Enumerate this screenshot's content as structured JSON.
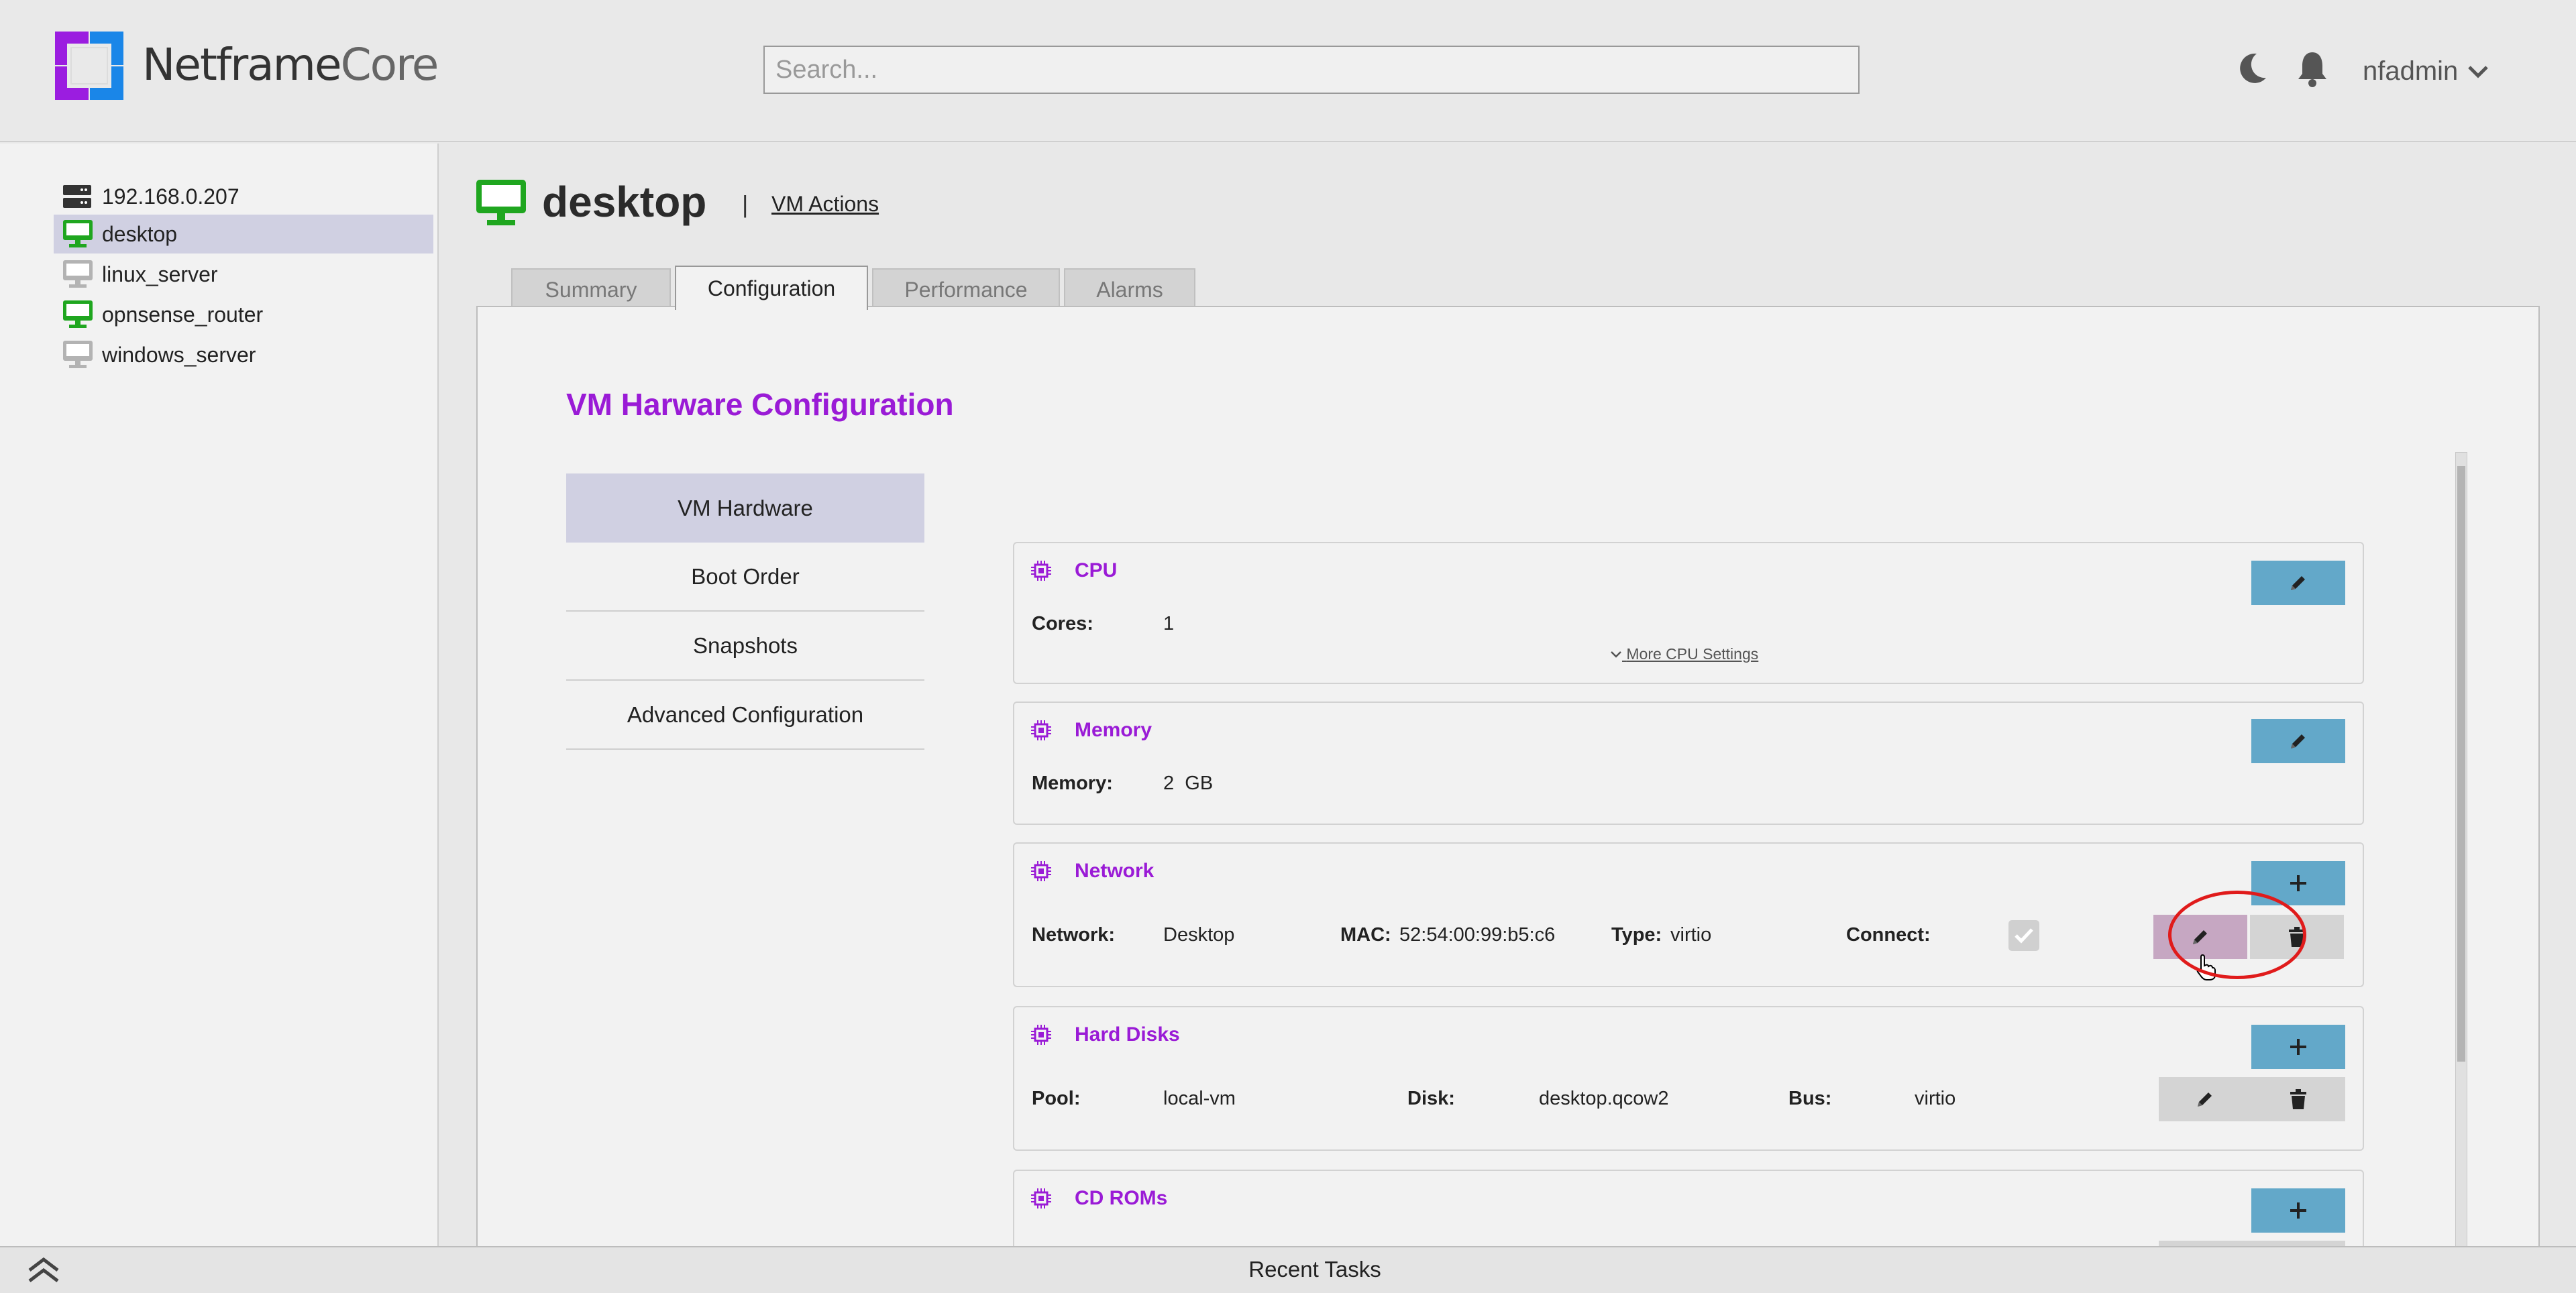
{
  "app": {
    "brand_part1": "Netframe",
    "brand_part2": "Core",
    "search_placeholder": "Search...",
    "user": "nfadmin",
    "icons": [
      "moon-icon",
      "bell-icon",
      "chevron-down-icon"
    ],
    "colors": {
      "accent": "#9a1bd6",
      "button": "#63a8c9",
      "running": "#1fa61f",
      "stopped": "#b3b3b3"
    }
  },
  "sidebar": {
    "items": [
      {
        "label": "192.168.0.207",
        "type": "host"
      },
      {
        "label": "desktop",
        "type": "vm",
        "state": "running",
        "selected": true
      },
      {
        "label": "linux_server",
        "type": "vm",
        "state": "stopped"
      },
      {
        "label": "opnsense_router",
        "type": "vm",
        "state": "running"
      },
      {
        "label": "windows_server",
        "type": "vm",
        "state": "stopped"
      }
    ]
  },
  "vm": {
    "name": "desktop",
    "separator": "|",
    "actions_label": "VM Actions"
  },
  "tabs": [
    {
      "label": "Summary"
    },
    {
      "label": "Configuration",
      "active": true
    },
    {
      "label": "Performance"
    },
    {
      "label": "Alarms"
    }
  ],
  "config": {
    "title": "VM Harware Configuration",
    "menu": [
      {
        "label": "VM Hardware",
        "active": true
      },
      {
        "label": "Boot Order"
      },
      {
        "label": "Snapshots"
      },
      {
        "label": "Advanced Configuration"
      }
    ],
    "cpu": {
      "title": "CPU",
      "cores_label": "Cores:",
      "cores_value": "1",
      "more_label": "More CPU Settings"
    },
    "memory": {
      "title": "Memory",
      "label": "Memory:",
      "value": "2",
      "unit": "GB"
    },
    "network": {
      "title": "Network",
      "network_label": "Network:",
      "network_value": "Desktop",
      "mac_label": "MAC:",
      "mac_value": "52:54:00:99:b5:c6",
      "type_label": "Type:",
      "type_value": "virtio",
      "connect_label": "Connect:",
      "connected": true
    },
    "disks": {
      "title": "Hard Disks",
      "pool_label": "Pool:",
      "pool_value": "local-vm",
      "disk_label": "Disk:",
      "disk_value": "desktop.qcow2",
      "bus_label": "Bus:",
      "bus_value": "virtio"
    },
    "cdroms": {
      "title": "CD ROMs"
    }
  },
  "footer": {
    "recent_tasks": "Recent Tasks"
  }
}
